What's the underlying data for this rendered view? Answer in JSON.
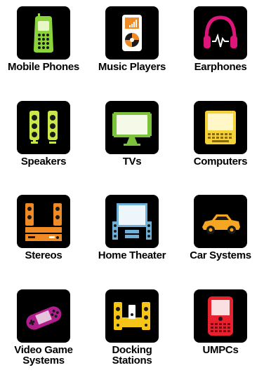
{
  "categories": [
    {
      "id": "mobile-phones",
      "label": "Mobile Phones",
      "icon": "mobile-phone-icon",
      "color": "#8cd43c"
    },
    {
      "id": "music-players",
      "label": "Music Players",
      "icon": "music-player-icon",
      "color": "#f08a24"
    },
    {
      "id": "earphones",
      "label": "Earphones",
      "icon": "earphones-icon",
      "color": "#e0157a"
    },
    {
      "id": "speakers",
      "label": "Speakers",
      "icon": "speakers-icon",
      "color": "#c8e84a"
    },
    {
      "id": "tvs",
      "label": "TVs",
      "icon": "tv-icon",
      "color": "#7cc23a"
    },
    {
      "id": "computers",
      "label": "Computers",
      "icon": "computer-icon",
      "color": "#f5d23a"
    },
    {
      "id": "stereos",
      "label": "Stereos",
      "icon": "stereo-icon",
      "color": "#f08a24"
    },
    {
      "id": "home-theater",
      "label": "Home Theater",
      "icon": "home-theater-icon",
      "color": "#6fb0d8"
    },
    {
      "id": "car-systems",
      "label": "Car Systems",
      "icon": "car-icon",
      "color": "#f5a623"
    },
    {
      "id": "video-game-systems",
      "label": "Video Game",
      "label2": "Systems",
      "icon": "game-console-icon",
      "color": "#b01e8c"
    },
    {
      "id": "docking-stations",
      "label": "Docking",
      "label2": "Stations",
      "icon": "docking-station-icon",
      "color": "#f5c518"
    },
    {
      "id": "umpcs",
      "label": "UMPCs",
      "icon": "umpc-icon",
      "color": "#e8212e"
    }
  ]
}
